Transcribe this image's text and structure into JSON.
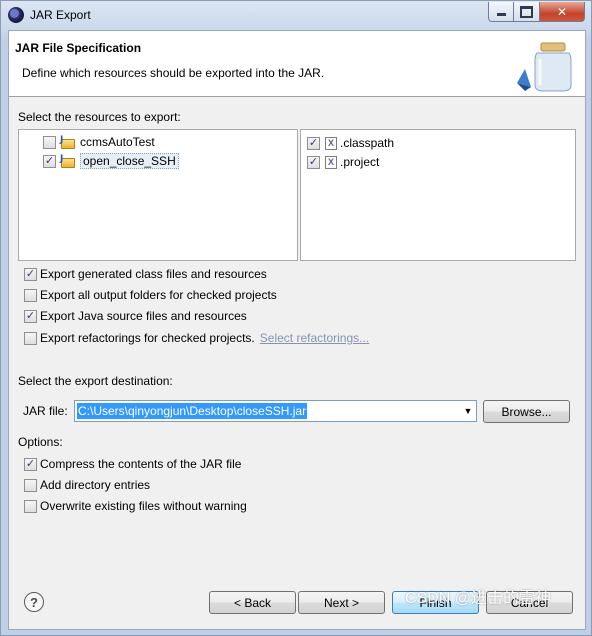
{
  "window": {
    "title": "JAR Export"
  },
  "header": {
    "title": "JAR File Specification",
    "description": "Define which resources should be exported into the JAR."
  },
  "resources": {
    "label": "Select the resources to export:",
    "projects": [
      {
        "name": "ccmsAutoTest",
        "checked": false
      },
      {
        "name": "open_close_SSH",
        "checked": true
      }
    ],
    "files": [
      {
        "name": ".classpath",
        "checked": true
      },
      {
        "name": ".project",
        "checked": true
      }
    ]
  },
  "export_options": [
    {
      "label": "Export generated class files and resources",
      "checked": true
    },
    {
      "label": "Export all output folders for checked projects",
      "checked": false
    },
    {
      "label": "Export Java source files and resources",
      "checked": true
    },
    {
      "label": "Export refactorings for checked projects.",
      "checked": false
    }
  ],
  "refactorings_link": "Select refactorings...",
  "destination": {
    "label": "Select the export destination:",
    "jar_file_label": "JAR file:",
    "jar_file_value": "C:\\Users\\qinyongjun\\Desktop\\closeSSH.jar",
    "browse_label": "Browse..."
  },
  "options": {
    "label": "Options:",
    "items": [
      {
        "label": "Compress the contents of the JAR file",
        "checked": true
      },
      {
        "label": "Add directory entries",
        "checked": false
      },
      {
        "label": "Overwrite existing files without warning",
        "checked": false
      }
    ]
  },
  "buttons": {
    "back": "< Back",
    "next": "Next >",
    "finish": "Finish",
    "cancel": "Cancel"
  },
  "watermark": "CSDN @进击的雷神"
}
